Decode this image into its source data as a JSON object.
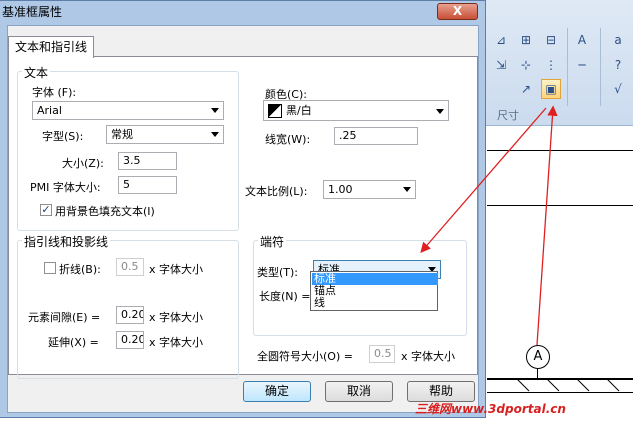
{
  "dialog": {
    "title": "基准框属性",
    "close_label": "X",
    "tab_label": "文本和指引线",
    "buttons": {
      "ok": "确定",
      "cancel": "取消",
      "help": "帮助"
    }
  },
  "text_group": {
    "title": "文本",
    "font_label": "字体 (F):",
    "font_value": "Arial",
    "style_label": "字型(S):",
    "style_value": "常规",
    "size_label": "大小(Z):",
    "size_value": "3.5",
    "pmi_label": "PMI 字体大小:",
    "pmi_value": "5",
    "fill_bg_label": "用背景色填充文本(I)",
    "fill_bg_checked": true,
    "color_label": "颜色(C):",
    "color_value": "黑/白",
    "linewidth_label": "线宽(W):",
    "linewidth_value": ".25",
    "ratio_label": "文本比例(L):",
    "ratio_value": "1.00"
  },
  "leader_group": {
    "title": "指引线和投影线",
    "fold_label": "折线(B):",
    "fold_checked": false,
    "fold_value": "0.5",
    "fold_unit": "x 字体大小",
    "gap_label": "元素间隙(E) =",
    "gap_value": "0.20",
    "gap_unit": "x 字体大小",
    "ext_label": "延伸(X) =",
    "ext_value": "0.20",
    "ext_unit": "x 字体大小"
  },
  "terminator_group": {
    "title": "端符",
    "type_label": "类型(T):",
    "type_value": "标准",
    "length_label": "长度(N) =",
    "options": [
      "标准",
      "锚点",
      "线"
    ],
    "selected_index": 0
  },
  "circle_symbol": {
    "label": "全圆符号大小(O) =",
    "value": "0.5",
    "unit": "x 字体大小"
  },
  "background_app": {
    "group_label": "尺寸",
    "callout_letter": "A",
    "icons": [
      "dimension-icon",
      "grid-dimension-icon",
      "text-edit-icon",
      "align-icon",
      "properties-icon",
      "note-icon",
      "label-icon",
      "check-icon"
    ]
  },
  "watermark": "三维网www.3dportal.cn",
  "colors": {
    "arrow": "#e02020",
    "selection": "#3399ff",
    "title_bar": "#aec8e6",
    "default_button": "#bee6fd"
  }
}
